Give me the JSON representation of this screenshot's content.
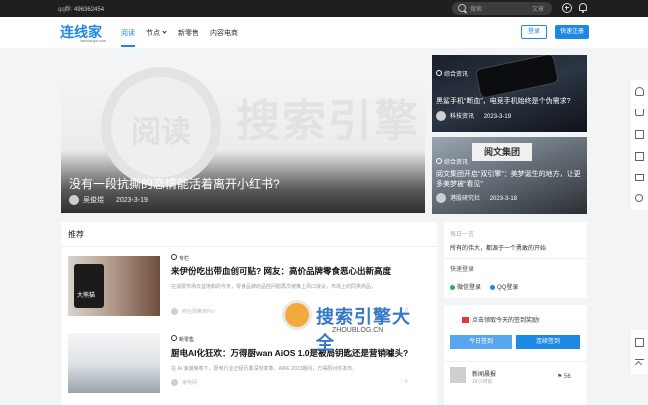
{
  "topbar": {
    "qq_label": "qq群:",
    "qq_number": "496362454",
    "search_placeholder": "搜索",
    "search_scope": "文章"
  },
  "header": {
    "logo": "连线家",
    "logo_sub": "lianxianjia.com",
    "nav": [
      {
        "label": "阅读",
        "active": true
      },
      {
        "label": "节点"
      },
      {
        "label": "新零售"
      },
      {
        "label": "内容电商"
      }
    ],
    "login_label": "登录",
    "register_label": "快速注册"
  },
  "hero": {
    "brand_watermark": "搜索引擎",
    "circle_text": "阅读",
    "title": "没有一段抗撕的恋情能活着离开小红书?",
    "author": "吴俊煜",
    "date": "2023-3-19"
  },
  "side_cards": [
    {
      "category": "综合资讯",
      "title": "黑鲨手机“断血”，电竞手机始终是个伪需求?",
      "author": "科技资讯",
      "date": "2023-3-19"
    },
    {
      "category": "综合资讯",
      "sign": "阅文集团",
      "title": "阅文集团开启“双引擎”：美梦诞生的地方，让更多美梦被“看见”",
      "author": "港股研究社",
      "date": "2023-3-18"
    }
  ],
  "feed": {
    "section_title": "推荐",
    "items": [
      {
        "tag": "专栏",
        "title": "来伊份吃出带血创可贴? 网友：高价品牌零食恶心出新高度",
        "summary": "在消费市场日益饱和的今天，零食品牌的品控问题再次被推上风口浪尖，市场上的同类商品，",
        "author": "商业观察家Pro",
        "thumb_text": "大熊猫",
        "stats": "0"
      },
      {
        "tag": "新零售",
        "title": "厨电AI化狂欢：万得厨wan AiOS 1.0是被局钥匙还是营销噱头?",
        "summary": "在 AI 浪潮席卷下，厨电行业正经历着深刻变革，AWE 2023期间，万得厨对外发布，",
        "author": "家电网",
        "stats": "0"
      }
    ]
  },
  "panel_quote": {
    "label": "每日一言",
    "quote": "所有的伟大，都源于一个勇敢的开始",
    "login_label": "快速登录",
    "login_options": [
      {
        "label": "微信登录",
        "color": "#2bb24c"
      },
      {
        "label": "QQ登录",
        "color": "#1e88e5"
      }
    ]
  },
  "panel_checkin": {
    "promo": "点击领取今天的签到奖励!",
    "today_label": "今日签到",
    "streak_label": "连续签到",
    "user_name": "新闻晨报",
    "user_sub": "16小时前",
    "user_badge": "56"
  },
  "watermark": {
    "text": "搜索引擎大全",
    "sub": "ZHOUBLOG.CN"
  }
}
